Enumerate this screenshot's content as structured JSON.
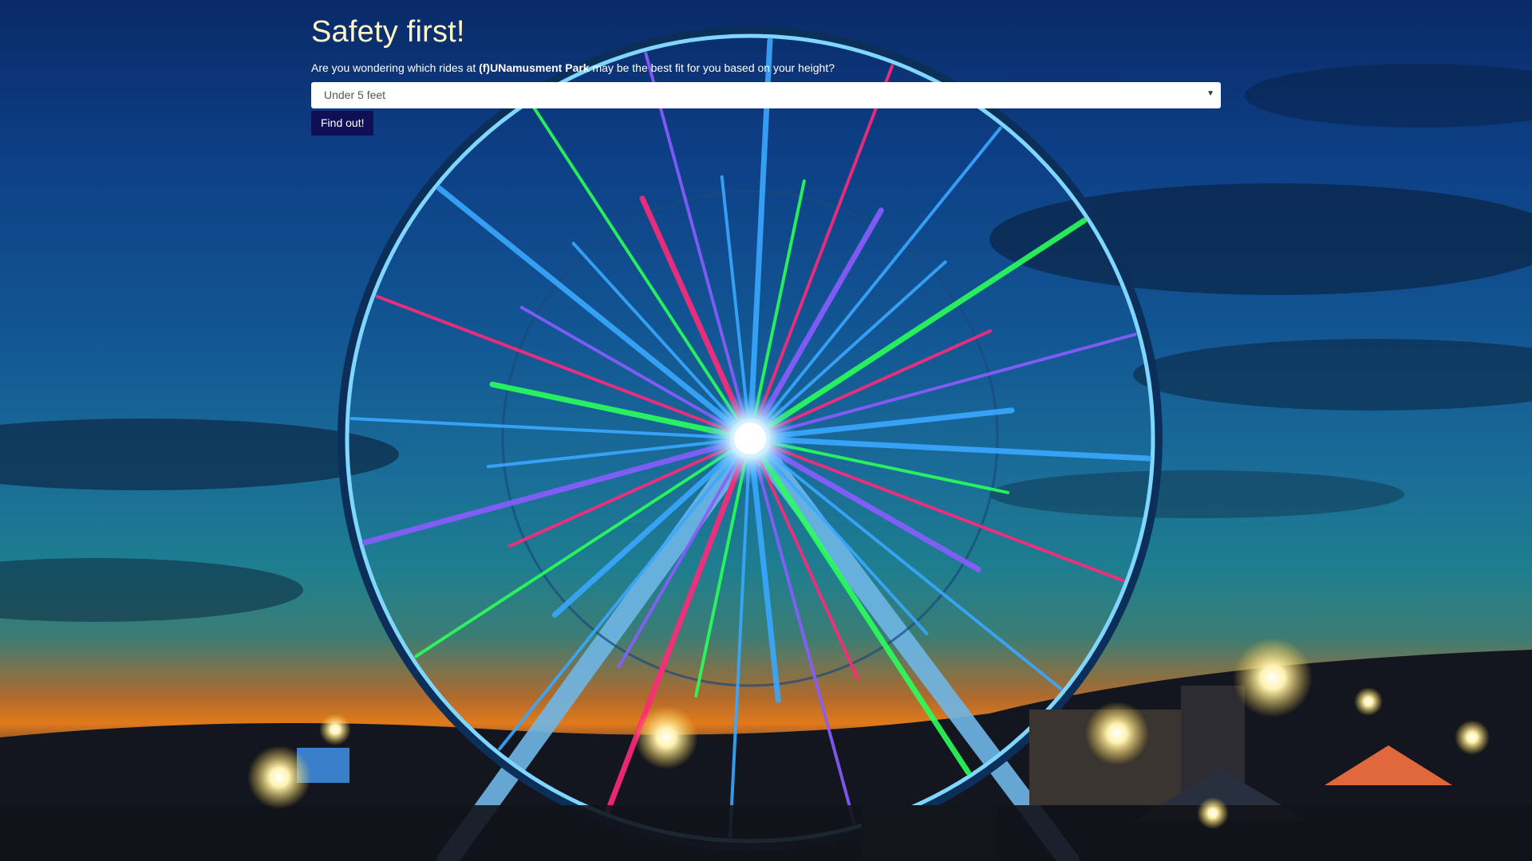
{
  "page": {
    "title": "Safety first!",
    "intro_before": "Are you wondering which rides at ",
    "park_name": "(f)UNamusment Park",
    "intro_after": " may be the best fit for you based on your height?"
  },
  "height_select": {
    "selected": "Under 5 feet"
  },
  "find_button": {
    "label": "Find out!"
  },
  "colors": {
    "title": "#fff6c9",
    "button_bg": "#0f0f55",
    "spoke_blue": "#3aa8ff",
    "spoke_green": "#2bff5a",
    "spoke_pink": "#ff2a7a",
    "spoke_violet": "#8a5cff"
  },
  "icons": {
    "select_caret": "chevron-down-icon"
  }
}
